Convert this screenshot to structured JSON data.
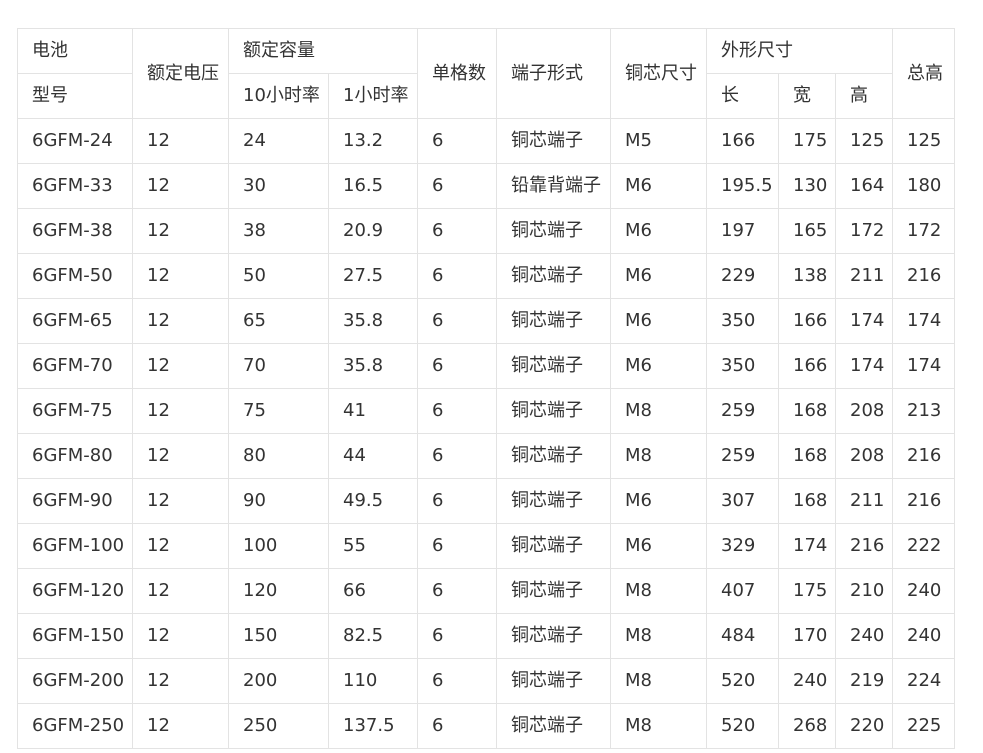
{
  "header": {
    "battery": "电池",
    "model": "型号",
    "rated_voltage": "额定电压",
    "rated_capacity": "额定容量",
    "rate_10h": "10小时率",
    "rate_1h": "1小时率",
    "cells": "单格数",
    "terminal_type": "端子形式",
    "copper_core_size": "铜芯尺寸",
    "dimensions": "外形尺寸",
    "length": "长",
    "width": "宽",
    "height": "高",
    "total_height": "总高"
  },
  "rows": [
    [
      "6GFM-24",
      "12",
      "24",
      "13.2",
      "6",
      "铜芯端子",
      "M5",
      "166",
      "175",
      "125",
      "125"
    ],
    [
      "6GFM-33",
      "12",
      "30",
      "16.5",
      "6",
      "铅靠背端子",
      "M6",
      "195.5",
      "130",
      "164",
      "180"
    ],
    [
      "6GFM-38",
      "12",
      "38",
      "20.9",
      "6",
      "铜芯端子",
      "M6",
      "197",
      "165",
      "172",
      "172"
    ],
    [
      "6GFM-50",
      "12",
      "50",
      "27.5",
      "6",
      "铜芯端子",
      "M6",
      "229",
      "138",
      "211",
      "216"
    ],
    [
      "6GFM-65",
      "12",
      "65",
      "35.8",
      "6",
      "铜芯端子",
      "M6",
      "350",
      "166",
      "174",
      "174"
    ],
    [
      "6GFM-70",
      "12",
      "70",
      "35.8",
      "6",
      "铜芯端子",
      "M6",
      "350",
      "166",
      "174",
      "174"
    ],
    [
      "6GFM-75",
      "12",
      "75",
      "41",
      "6",
      "铜芯端子",
      "M8",
      "259",
      "168",
      "208",
      "213"
    ],
    [
      "6GFM-80",
      "12",
      "80",
      "44",
      "6",
      "铜芯端子",
      "M8",
      "259",
      "168",
      "208",
      "216"
    ],
    [
      "6GFM-90",
      "12",
      "90",
      "49.5",
      "6",
      "铜芯端子",
      "M6",
      "307",
      "168",
      "211",
      "216"
    ],
    [
      "6GFM-100",
      "12",
      "100",
      "55",
      "6",
      "铜芯端子",
      "M6",
      "329",
      "174",
      "216",
      "222"
    ],
    [
      "6GFM-120",
      "12",
      "120",
      "66",
      "6",
      "铜芯端子",
      "M8",
      "407",
      "175",
      "210",
      "240"
    ],
    [
      "6GFM-150",
      "12",
      "150",
      "82.5",
      "6",
      "铜芯端子",
      "M8",
      "484",
      "170",
      "240",
      "240"
    ],
    [
      "6GFM-200",
      "12",
      "200",
      "110",
      "6",
      "铜芯端子",
      "M8",
      "520",
      "240",
      "219",
      "224"
    ],
    [
      "6GFM-250",
      "12",
      "250",
      "137.5",
      "6",
      "铜芯端子",
      "M8",
      "520",
      "268",
      "220",
      "225"
    ]
  ]
}
